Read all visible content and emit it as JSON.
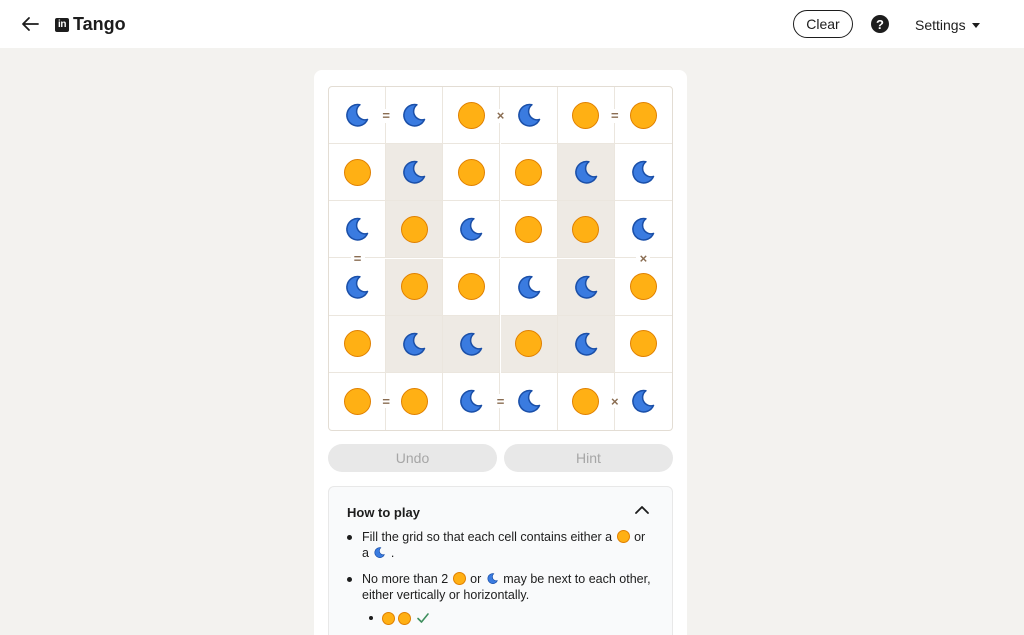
{
  "header": {
    "logo_text": "in",
    "title": "Tango",
    "clear_label": "Clear",
    "help_label": "?",
    "settings_label": "Settings",
    "icons": {
      "back": "back-arrow-icon",
      "help": "help-icon",
      "settings_caret": "caret-down-icon"
    }
  },
  "board": {
    "rows": 6,
    "cols": 6,
    "cells": [
      [
        "moon",
        "moon",
        "sun",
        "moon",
        "sun",
        "sun"
      ],
      [
        "sun",
        "moon",
        "sun",
        "sun",
        "moon",
        "moon"
      ],
      [
        "moon",
        "sun",
        "moon",
        "sun",
        "sun",
        "moon"
      ],
      [
        "moon",
        "sun",
        "sun",
        "moon",
        "moon",
        "sun"
      ],
      [
        "sun",
        "moon",
        "moon",
        "sun",
        "moon",
        "sun"
      ],
      [
        "sun",
        "sun",
        "moon",
        "moon",
        "sun",
        "moon"
      ]
    ],
    "locked": [
      [
        1,
        1
      ],
      [
        1,
        4
      ],
      [
        2,
        1
      ],
      [
        2,
        4
      ],
      [
        3,
        1
      ],
      [
        3,
        4
      ],
      [
        4,
        1
      ],
      [
        4,
        2
      ],
      [
        4,
        3
      ],
      [
        4,
        4
      ]
    ],
    "signs": [
      {
        "row": 0,
        "col": 0,
        "dir": "right",
        "symbol": "="
      },
      {
        "row": 0,
        "col": 2,
        "dir": "right",
        "symbol": "×"
      },
      {
        "row": 0,
        "col": 4,
        "dir": "right",
        "symbol": "="
      },
      {
        "row": 2,
        "col": 0,
        "dir": "down",
        "symbol": "="
      },
      {
        "row": 2,
        "col": 5,
        "dir": "down",
        "symbol": "×"
      },
      {
        "row": 5,
        "col": 0,
        "dir": "right",
        "symbol": "="
      },
      {
        "row": 5,
        "col": 2,
        "dir": "right",
        "symbol": "="
      },
      {
        "row": 5,
        "col": 4,
        "dir": "right",
        "symbol": "×"
      }
    ],
    "colors": {
      "sun_fill": "#ffb014",
      "sun_stroke": "#e08000",
      "moon_fill": "#3a7be0",
      "moon_stroke": "#1a4fa8",
      "locked_bg": "#eeeae4",
      "sign": "#8a6d52"
    }
  },
  "actions": {
    "undo_label": "Undo",
    "hint_label": "Hint"
  },
  "how_to_play": {
    "title": "How to play",
    "rule1": {
      "part1": "Fill the grid so that each cell contains either a",
      "part2": "or",
      "part3": "a",
      "part4": "."
    },
    "rule2": {
      "part1": "No more than 2",
      "part2": "or",
      "part3": "may be next to each other, either vertically or horizontally."
    },
    "icons": {
      "collapse": "chevron-up-icon",
      "check": "check-icon"
    }
  }
}
